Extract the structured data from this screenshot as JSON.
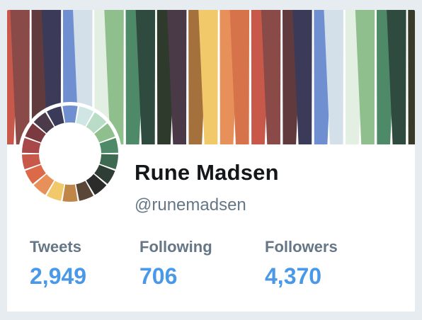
{
  "profile": {
    "name": "Rune Madsen",
    "handle": "@runemadsen"
  },
  "stats": [
    {
      "label": "Tweets",
      "value": "2,949"
    },
    {
      "label": "Following",
      "value": "706"
    },
    {
      "label": "Followers",
      "value": "4,370"
    }
  ],
  "banner_colors": [
    "#c8584a",
    "#8a4a48",
    "#603a3c",
    "#3b3a58",
    "#6f8fd0",
    "#d3e0ea",
    "#e4efe4",
    "#8fbf8c",
    "#4e8a68",
    "#2f4a3e",
    "#2e3a2c",
    "#4a3a48",
    "#a4703c",
    "#f2c96a",
    "#e8905a",
    "#d6734a",
    "#c8584a",
    "#8a4a48",
    "#603a3c",
    "#3b3a58",
    "#6f8fd0",
    "#d3e0ea",
    "#e4efe4",
    "#8fbf8c",
    "#4e8a68",
    "#2f4a3e",
    "#3a3a2a"
  ],
  "avatar_colors": [
    "#6f8fd0",
    "#cfe6e4",
    "#b8dcc6",
    "#8fbf8c",
    "#4e8a68",
    "#3e6a52",
    "#2f3e34",
    "#2c2c2a",
    "#5a4636",
    "#c08648",
    "#f2c96a",
    "#e8905a",
    "#dc6a48",
    "#c8584a",
    "#a84848",
    "#7a3a40",
    "#4a3a4a",
    "#3b3a58"
  ]
}
